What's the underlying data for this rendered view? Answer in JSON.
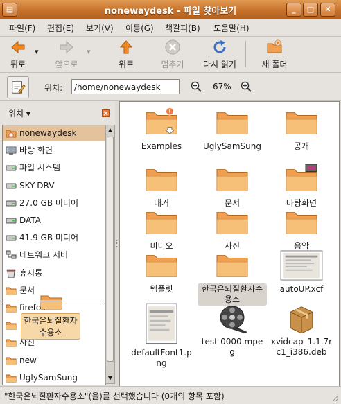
{
  "window": {
    "title": "nonewaydesk",
    "app": "파일 찾아보기",
    "separator": " - "
  },
  "menubar": [
    "파일(F)",
    "편집(E)",
    "보기(V)",
    "이동(G)",
    "책갈피(B)",
    "도움말(H)"
  ],
  "toolbar": {
    "back": "뒤로",
    "forward": "앞으로",
    "up": "위로",
    "stop": "멈추기",
    "reload": "다시 읽기",
    "new_folder": "새 폴더",
    "dropdown": "▾"
  },
  "location": {
    "label": "위치:",
    "path": "/home/nonewaydesk",
    "zoom": "67%"
  },
  "sidebar": {
    "header": "위치",
    "items": [
      {
        "label": "nonewaydesk",
        "icon": "home-folder-icon",
        "selected": true
      },
      {
        "label": "바탕 화면",
        "icon": "desktop-icon"
      },
      {
        "label": "파일 시스템",
        "icon": "filesystem-icon"
      },
      {
        "label": "SKY-DRV",
        "icon": "drive-icon"
      },
      {
        "label": "27.0 GB 미디어",
        "icon": "drive-icon"
      },
      {
        "label": "DATA",
        "icon": "drive-icon"
      },
      {
        "label": "41.9 GB 미디어",
        "icon": "drive-icon"
      },
      {
        "label": "네트워크 서버",
        "icon": "network-icon"
      },
      {
        "label": "휴지통",
        "icon": "trash-icon"
      },
      {
        "label": "문서",
        "icon": "folder-icon"
      },
      {
        "label": "firefox",
        "icon": "folder-icon"
      },
      {
        "label": "",
        "icon": "folder-icon"
      },
      {
        "label": "사진",
        "icon": "folder-icon"
      },
      {
        "label": "new",
        "icon": "folder-icon"
      },
      {
        "label": "UglySamSung",
        "icon": "folder-icon"
      }
    ]
  },
  "files": [
    {
      "name": "Examples",
      "icon": "folder-link-icon"
    },
    {
      "name": "UglySamSung",
      "icon": "folder-icon"
    },
    {
      "name": "공개",
      "icon": "folder-icon"
    },
    {
      "name": "내거",
      "icon": "folder-icon"
    },
    {
      "name": "문서",
      "icon": "folder-icon"
    },
    {
      "name": "바탕화면",
      "icon": "folder-desktop-icon"
    },
    {
      "name": "비디오",
      "icon": "folder-icon"
    },
    {
      "name": "사진",
      "icon": "folder-icon"
    },
    {
      "name": "음악",
      "icon": "folder-icon"
    },
    {
      "name": "템플릿",
      "icon": "folder-icon"
    },
    {
      "name": "한국은뇌질환자수용소",
      "icon": "folder-icon",
      "selected": true
    },
    {
      "name": "autoUP.xcf",
      "icon": "image-thumbnail-icon"
    },
    {
      "name": "defaultFont1.png",
      "icon": "image-thumbnail-icon"
    },
    {
      "name": "test-0000.mpeg",
      "icon": "film-reel-icon"
    },
    {
      "name": "xvidcap_1.1.7rc1_i386.deb",
      "icon": "package-icon"
    }
  ],
  "drag_ghost": "한국은뇌질환자수용소",
  "status": "\"한국은뇌질환자수용소\"(을)를 선택했습니다 (0개의 항목 포함)",
  "colors": {
    "titlebar": "#c7722c",
    "folder": "#f0a050",
    "selection": "#e4c29c",
    "accent": "#e07a20"
  }
}
